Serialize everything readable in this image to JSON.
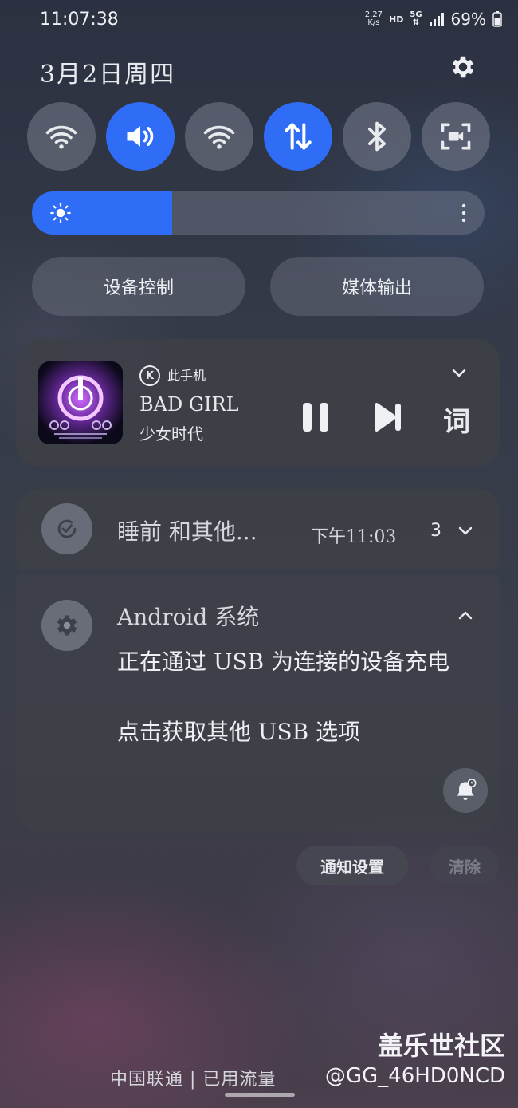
{
  "status_bar": {
    "time": "11:07:38",
    "net_speed_value": "2.27",
    "net_speed_unit": "K/s",
    "hd_badge": "HD",
    "network_type": "5G",
    "battery_percent": "69%"
  },
  "header": {
    "date": "3月2日周四",
    "settings_icon": "gear-icon"
  },
  "quick_tiles": [
    {
      "name": "wifi",
      "icon": "wifi-icon",
      "active": false
    },
    {
      "name": "sound",
      "icon": "volume-icon",
      "active": true
    },
    {
      "name": "hotspot",
      "icon": "wifi-icon",
      "active": false
    },
    {
      "name": "mobile-data",
      "icon": "data-arrows-icon",
      "active": true
    },
    {
      "name": "bluetooth",
      "icon": "bluetooth-icon",
      "active": false
    },
    {
      "name": "screen-recorder",
      "icon": "screen-record-icon",
      "active": false
    }
  ],
  "brightness": {
    "level": 0.31
  },
  "actions": {
    "device_control": "设备控制",
    "media_output": "媒体输出"
  },
  "media": {
    "source_badge": "K",
    "source": "此手机",
    "title": "BAD GIRL",
    "artist": "少女时代",
    "lyrics_button": "词"
  },
  "notifications": [
    {
      "app": "睡前 和其他...",
      "time": "下午11:03",
      "count": "3"
    },
    {
      "app": "Android 系统",
      "line1": "正在通过 USB 为连接的设备充电",
      "line2": "点击获取其他 USB 选项"
    }
  ],
  "footer": {
    "notification_settings": "通知设置",
    "clear": "清除",
    "carrier": "中国联通 | 已用流量",
    "watermark_title": "盖乐世社区",
    "watermark_user": "@GG_46HD0NCD"
  }
}
